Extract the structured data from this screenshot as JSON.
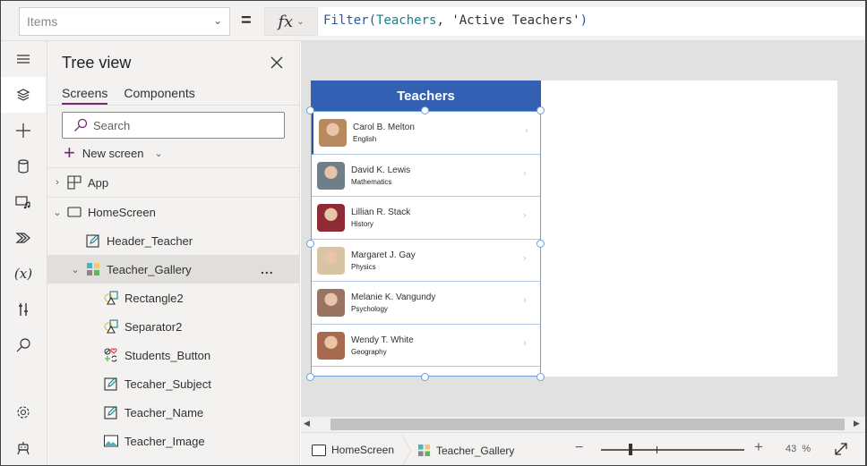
{
  "formula_bar": {
    "property": "Items",
    "equals": "=",
    "fx_label": "fx",
    "formula": {
      "fn": "Filter",
      "open": "(",
      "arg1": "Teachers",
      "sep": ", ",
      "arg2": "'Active Teachers'",
      "close": ")"
    }
  },
  "tree_view": {
    "title": "Tree view",
    "tabs": [
      {
        "label": "Screens",
        "active": true
      },
      {
        "label": "Components",
        "active": false
      }
    ],
    "search_placeholder": "Search",
    "new_screen_label": "New screen",
    "nodes": [
      {
        "label": "App",
        "icon": "app-icon",
        "expander": "chevron-right"
      },
      {
        "label": "HomeScreen",
        "icon": "screen-icon",
        "expander": "chevron-down"
      },
      {
        "label": "Header_Teacher",
        "icon": "label-icon"
      },
      {
        "label": "Teacher_Gallery",
        "icon": "gallery-icon",
        "expander": "chevron-down",
        "selected": true,
        "more": "..."
      },
      {
        "label": "Rectangle2",
        "icon": "shape-icon"
      },
      {
        "label": "Separator2",
        "icon": "shape-icon"
      },
      {
        "label": "Students_Button",
        "icon": "button-icon"
      },
      {
        "label": "Tecaher_Subject",
        "icon": "label-icon"
      },
      {
        "label": "Teacher_Name",
        "icon": "label-icon"
      },
      {
        "label": "Teacher_Image",
        "icon": "image-icon"
      }
    ]
  },
  "rail": [
    "menu-icon",
    "tree-view-icon",
    "insert-icon",
    "data-icon",
    "media-icon",
    "power-automate-icon",
    "variables-icon",
    "advanced-tools-icon",
    "search-icon",
    "settings-icon",
    "virtual-agent-icon"
  ],
  "app": {
    "header": "Teachers",
    "teachers": [
      {
        "name": "Carol B. Melton",
        "subject": "English",
        "color": "#b98a5e"
      },
      {
        "name": "David K. Lewis",
        "subject": "Mathematics",
        "color": "#6e7f8a"
      },
      {
        "name": "Lillian R. Stack",
        "subject": "History",
        "color": "#8e2b34"
      },
      {
        "name": "Margaret J. Gay",
        "subject": "Physics",
        "color": "#d8c3a5"
      },
      {
        "name": "Melanie K. Vangundy",
        "subject": "Psychology",
        "color": "#9a7462"
      },
      {
        "name": "Wendy T. White",
        "subject": "Geography",
        "color": "#a86a4e"
      }
    ]
  },
  "status_bar": {
    "screen": "HomeScreen",
    "control": "Teacher_Gallery",
    "zoom_minus": "−",
    "zoom_plus": "+",
    "zoom_value": "43",
    "zoom_unit": "%"
  },
  "colors": {
    "accent": "#742774",
    "header_blue": "#3360b3",
    "selection": "#6ca0dc"
  }
}
